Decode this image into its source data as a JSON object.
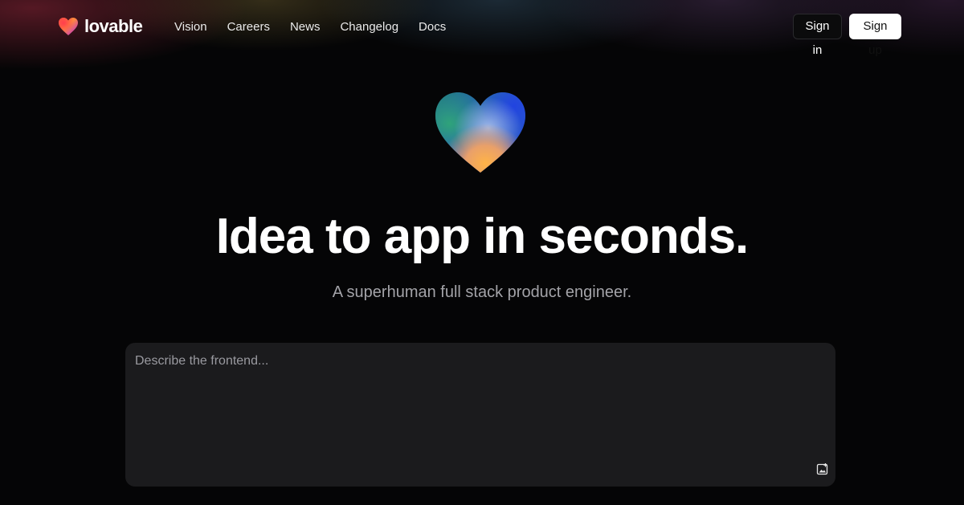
{
  "brand": {
    "name": "lovable"
  },
  "nav": {
    "items": [
      {
        "label": "Vision"
      },
      {
        "label": "Careers"
      },
      {
        "label": "News"
      },
      {
        "label": "Changelog"
      },
      {
        "label": "Docs"
      }
    ]
  },
  "auth": {
    "sign_in_label": "Sign in",
    "sign_up_label": "Sign up"
  },
  "hero": {
    "title": "Idea to app in seconds.",
    "subtitle": "A superhuman full stack product engineer.",
    "heart_icon": "gradient-heart-icon"
  },
  "prompt": {
    "placeholder": "Describe the frontend...",
    "value": "",
    "attach_icon": "image-upload-icon"
  },
  "colors": {
    "background": "#050506",
    "prompt_background": "#1b1b1d",
    "subtitle": "#a3a3a8",
    "button_light": "#ffffff"
  }
}
